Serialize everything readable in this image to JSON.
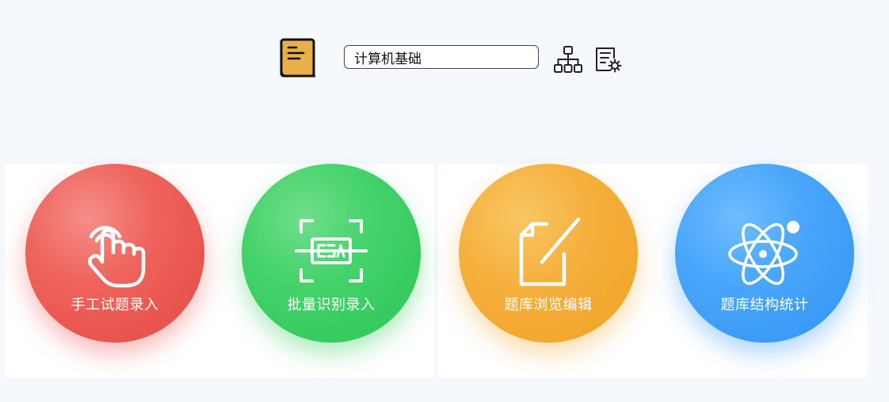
{
  "toolbar": {
    "selected_bank": "计算机基础"
  },
  "tiles": [
    {
      "label": "手工试题录入",
      "color": "#ee645c",
      "icon": "tap-hand-icon"
    },
    {
      "label": "批量识别录入",
      "color": "#45d36b",
      "icon": "scan-icon"
    },
    {
      "label": "题库浏览编辑",
      "color": "#f5b13f",
      "icon": "edit-document-icon"
    },
    {
      "label": "题库结构统计",
      "color": "#4aa7fb",
      "icon": "atom-icon"
    }
  ]
}
